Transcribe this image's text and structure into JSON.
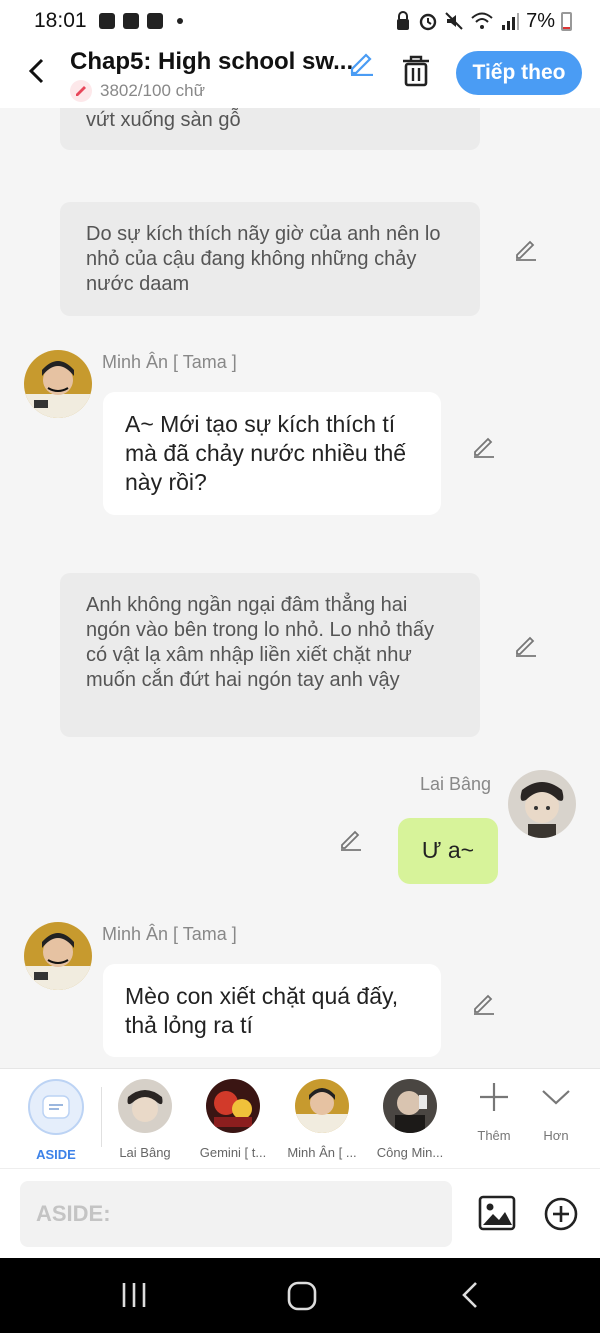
{
  "status_bar": {
    "time": "18:01",
    "battery": "7%"
  },
  "header": {
    "title": "Chap5: High school sw...",
    "word_count": "3802/100 chữ",
    "next_label": "Tiếp theo"
  },
  "messages": {
    "narration_0": "vứt xuống sàn gỗ",
    "narration_1": "Do sự kích thích nãy giờ của anh nên lo nhỏ của cậu đang không những chảy nước daam",
    "name_1": "Minh Ân [ Tama ]",
    "bubble_1": "A~ Mới tạo sự kích thích tí mà đã chảy nước nhiều thế này rồi?",
    "narration_2": "Anh không ngần ngại đâm thẳng hai ngón vào bên trong lo nhỏ. Lo nhỏ thấy có vật lạ xâm nhập liền xiết chặt như muốn cắn đứt hai ngón tay anh vậy",
    "name_2": "Lai Bâng",
    "bubble_2": "Ư a~",
    "name_3": "Minh Ân [ Tama ]",
    "bubble_3": "Mèo con xiết chặt quá đấy, thả lỏng ra tí"
  },
  "characters": [
    {
      "label": "ASIDE"
    },
    {
      "label": "Lai Bâng"
    },
    {
      "label": "Gemini [ t..."
    },
    {
      "label": "Minh Ân [ ..."
    },
    {
      "label": "Công Min..."
    }
  ],
  "controls": {
    "more_label": "Thêm",
    "collapse_label": "Hơn"
  },
  "input": {
    "placeholder": "ASIDE:"
  }
}
